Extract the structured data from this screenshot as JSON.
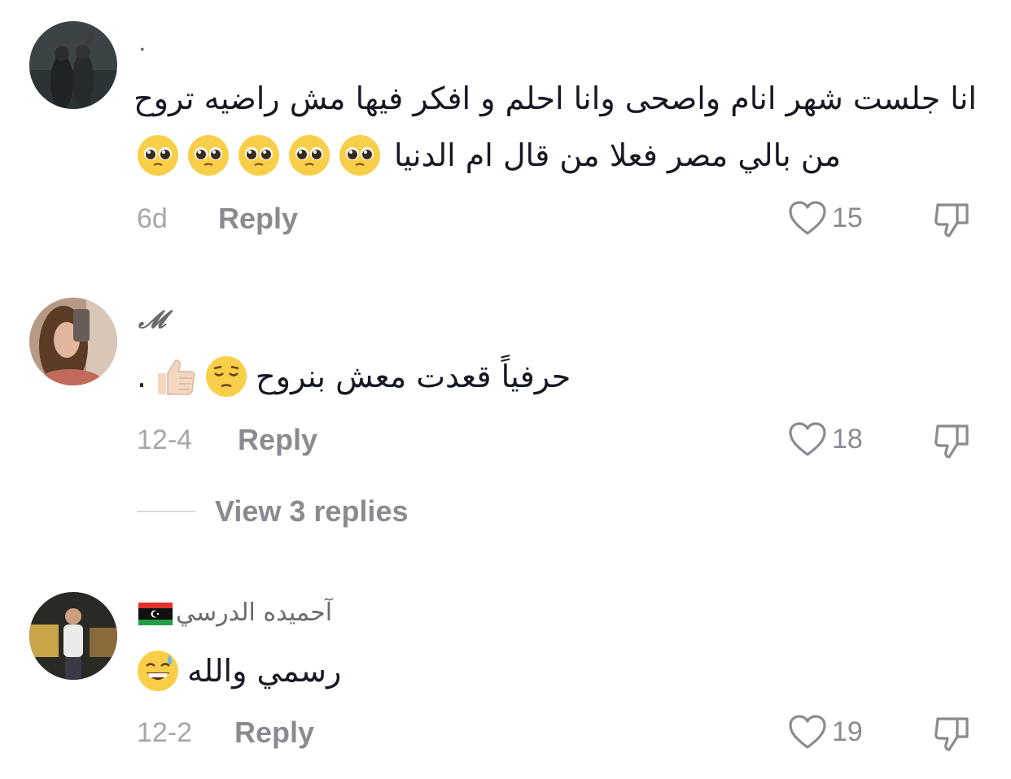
{
  "comments": [
    {
      "username": "·",
      "text_line1": "انا جلست شهر انام واصحى وانا احلم و افكر فيها مش راضيه تروح",
      "text_line2": "من بالي مصر فعلا من قال ام الدنيا",
      "emojis": [
        "pleading-face",
        "pleading-face",
        "pleading-face",
        "pleading-face",
        "pleading-face"
      ],
      "time": "6d",
      "reply_label": "Reply",
      "likes": "15"
    },
    {
      "username": "𝓜",
      "text": "حرفياً قعدت معش بنروح",
      "trailing": ".",
      "emojis": [
        "pensive-face",
        "thumbs-up-light-skin"
      ],
      "time": "12-4",
      "reply_label": "Reply",
      "likes": "18",
      "view_replies": "View 3 replies"
    },
    {
      "username": "آحميده الدرسي",
      "flag": "libya-flag",
      "text": "رسمي والله",
      "emojis": [
        "grinning-sweat-face"
      ],
      "time": "12-2",
      "reply_label": "Reply",
      "likes": "19"
    }
  ],
  "colors": {
    "text_primary": "#161823",
    "text_secondary": "#8a8b91",
    "time": "#a6a6aa",
    "divider": "#d9d9db"
  }
}
